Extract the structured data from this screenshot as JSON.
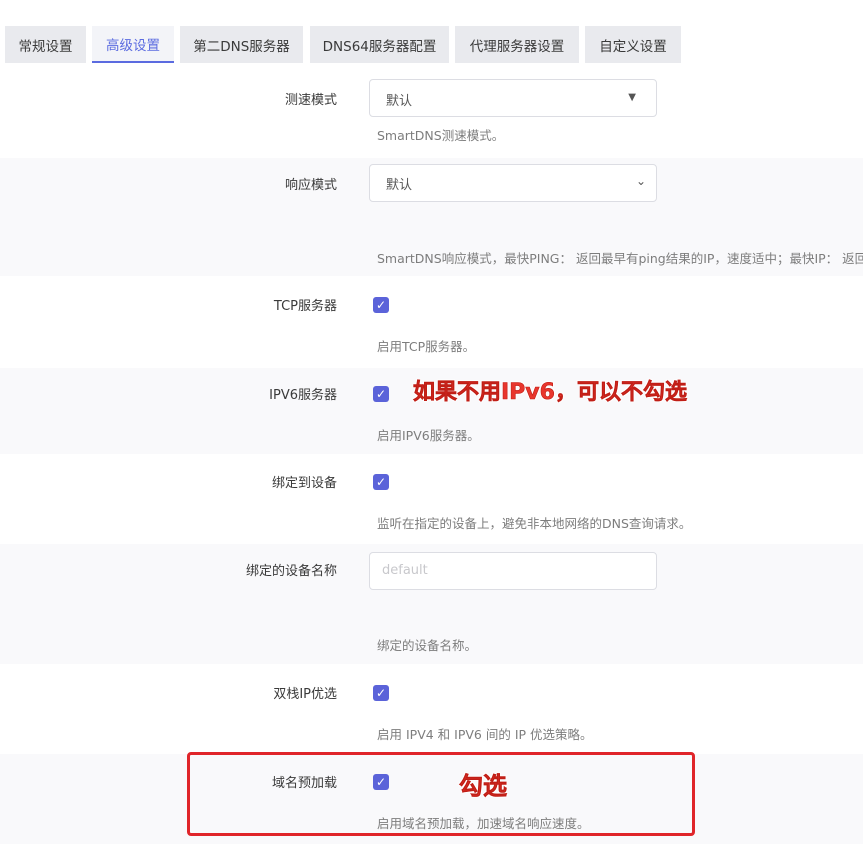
{
  "tabs": [
    "常规设置",
    "高级设置",
    "第二DNS服务器",
    "DNS64服务器配置",
    "代理服务器设置",
    "自定义设置"
  ],
  "active_tab": "高级设置",
  "settings": {
    "speed_mode": {
      "label": "测速模式",
      "value": "默认",
      "desc": "SmartDNS测速模式。"
    },
    "response_mode": {
      "label": "响应模式",
      "value": "默认",
      "desc": "SmartDNS响应模式，最快PING：  返回最早有ping结果的IP，速度适中；最快IP：  返回"
    },
    "tcp_server": {
      "label": "TCP服务器",
      "checked": true,
      "desc": "启用TCP服务器。"
    },
    "ipv6_server": {
      "label": "IPV6服务器",
      "checked": true,
      "desc": "启用IPV6服务器。"
    },
    "bind_device": {
      "label": "绑定到设备",
      "checked": true,
      "desc": "监听在指定的设备上，避免非本地网络的DNS查询请求。"
    },
    "bind_device_name": {
      "label": "绑定的设备名称",
      "placeholder": "default",
      "desc": "绑定的设备名称。"
    },
    "dualstack_ip": {
      "label": "双栈IP优选",
      "checked": true,
      "desc": "启用 IPV4 和 IPV6 间的 IP 优选策略。"
    },
    "prefetch_domain": {
      "label": "域名预加载",
      "checked": true,
      "desc": "启用域名预加载，加速域名响应速度。"
    }
  },
  "annotations": {
    "ipv6_note": "如果不用IPv6，可以不勾选",
    "prefetch_note": "勾选"
  },
  "colors": {
    "accent": "#5b63d9",
    "annotation": "#e8362d",
    "highlight_border": "#e0252a"
  },
  "icons": {
    "checkbox": "check-icon",
    "select": "dropdown-caret-icon"
  }
}
